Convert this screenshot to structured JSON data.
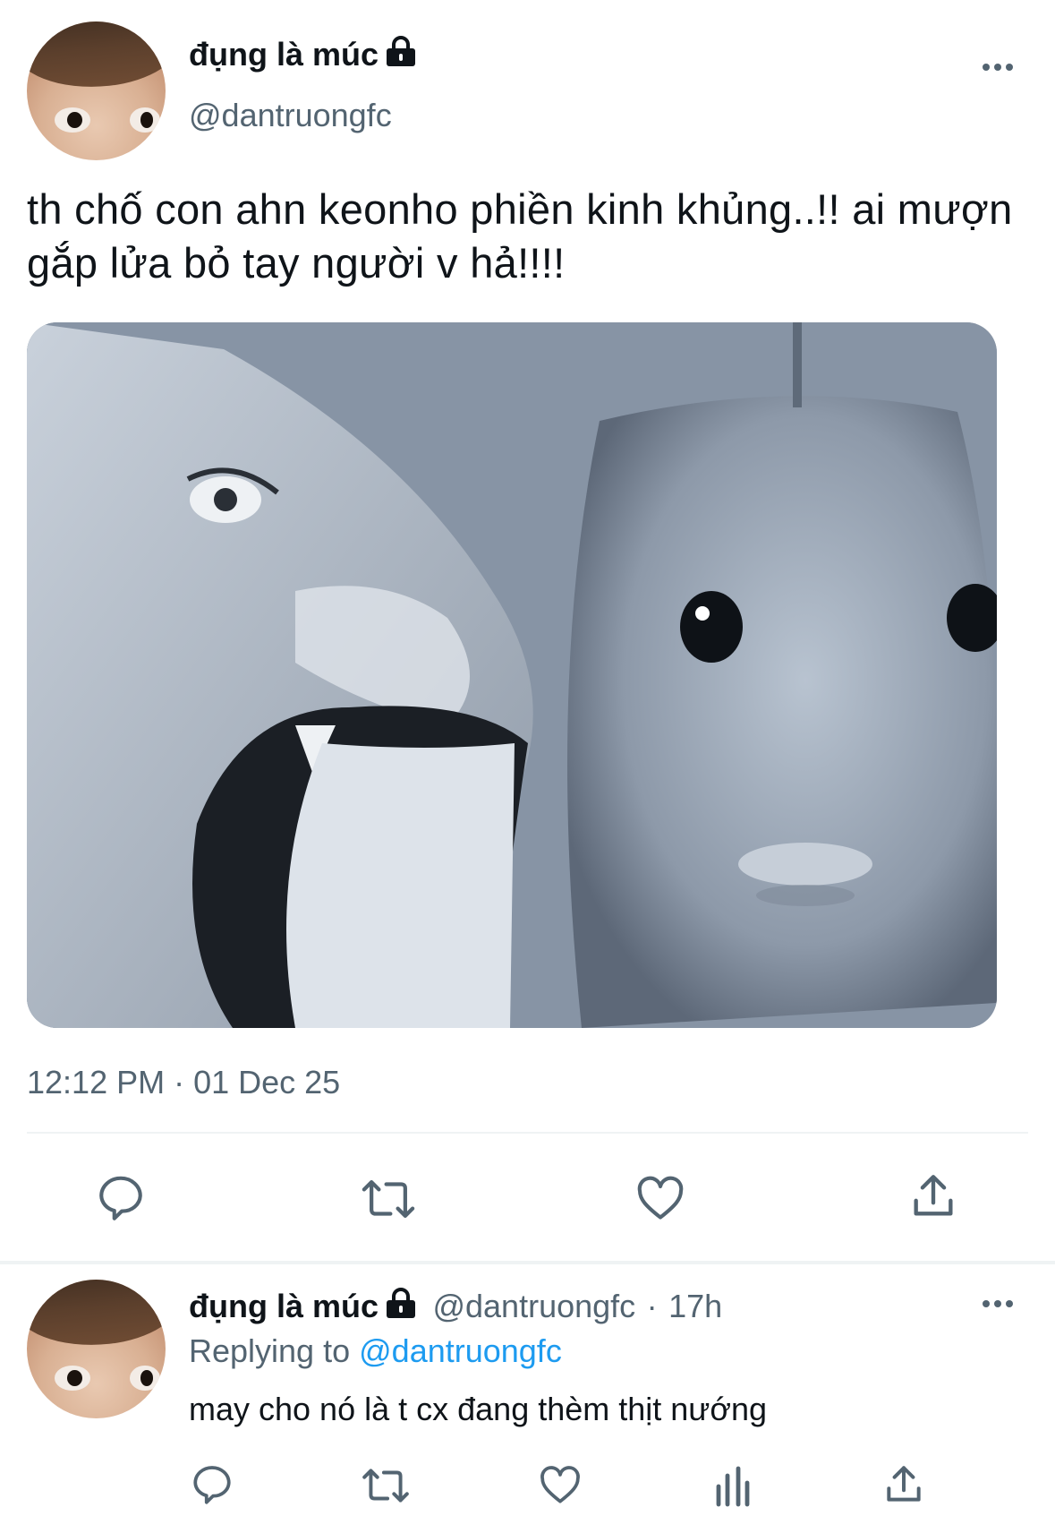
{
  "tweet": {
    "author_name": "đụng là múc",
    "author_handle": "@dantruongfc",
    "text": "th chố con ahn keonho phiền kinh khủng..!! ai mượn gắp lửa bỏ tay người v hả!!!!",
    "timestamp": "12:12 PM · 01 Dec 25",
    "actions": [
      "reply-icon",
      "retweet-icon",
      "like-icon",
      "share-icon"
    ]
  },
  "reply": {
    "author_name": "đụng là múc",
    "author_handle": "@dantruongfc",
    "separator": "·",
    "age": "17h",
    "replying_prefix": "Replying to",
    "replying_to": "@dantruongfc",
    "text": "may cho nó là t cx đang thèm thịt nướng",
    "actions": [
      "reply-icon",
      "retweet-icon",
      "like-icon",
      "analytics-icon",
      "share-icon"
    ]
  },
  "colors": {
    "text": "#0f1419",
    "secondary": "#536471",
    "link": "#1d9bf0",
    "divider": "#eff3f4"
  }
}
